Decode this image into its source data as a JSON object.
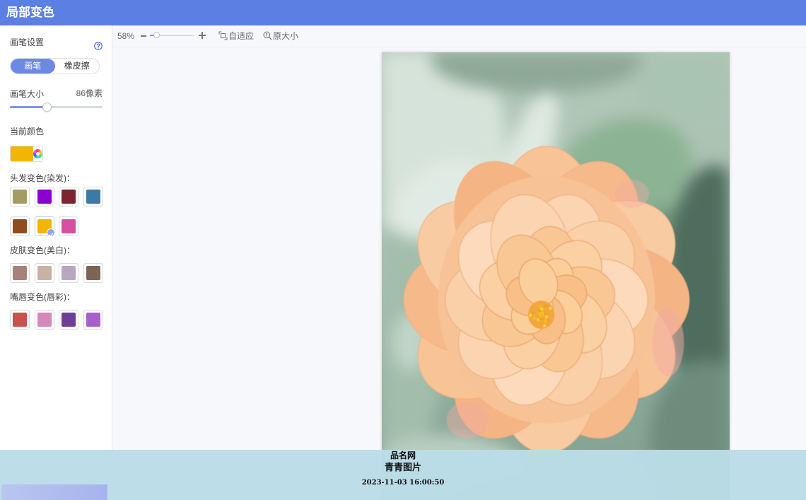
{
  "app": {
    "title": "局部变色"
  },
  "sidebar": {
    "brush_settings": {
      "label": "画笔设置",
      "help_icon": "help-question-icon"
    },
    "modes": [
      {
        "label": "画笔",
        "active": true
      },
      {
        "label": "橡皮擦",
        "active": false
      }
    ],
    "brush_size": {
      "label": "画笔大小",
      "value_text": "86像素",
      "level": 0.4
    },
    "current_color": {
      "label": "当前颜色",
      "color": "#f2b600",
      "picker_icon": "color-wheel-icon"
    },
    "hair": {
      "label": "头发变色(染发)：",
      "swatches": [
        "#a39d63",
        "#8a02cf",
        "#7b2531",
        "#3b79a6",
        "#8d4d1f",
        "#f2b600",
        "#d64fa3"
      ],
      "selected_index": 5
    },
    "skin": {
      "label": "皮肤变色(美白)：",
      "swatches": [
        "#a7827a",
        "#c9b2a4",
        "#b6a7bf",
        "#7e6454"
      ],
      "selected_index": null
    },
    "lips": {
      "label": "嘴唇变色(唇彩)：",
      "swatches": [
        "#c9524f",
        "#d588b9",
        "#6d3f98",
        "#a85fcc"
      ],
      "selected_index": null
    }
  },
  "toolbar": {
    "zoom_text": "58%",
    "zoom_level": 0.15,
    "zoom_out_icon": "minus-icon",
    "zoom_in_icon": "plus-icon",
    "fit": {
      "label": "自适应",
      "icon": "fit-screen-icon"
    },
    "original": {
      "label": "原大小",
      "icon": "zoom-original-icon"
    }
  },
  "watermark": {
    "site": "品名网",
    "name": "青青图片",
    "timestamp": "2023-11-03 16:00:50"
  },
  "colors": {
    "header": "#5b7fe2",
    "accent": "#6c89e4",
    "watermark_band": "#badde7"
  }
}
